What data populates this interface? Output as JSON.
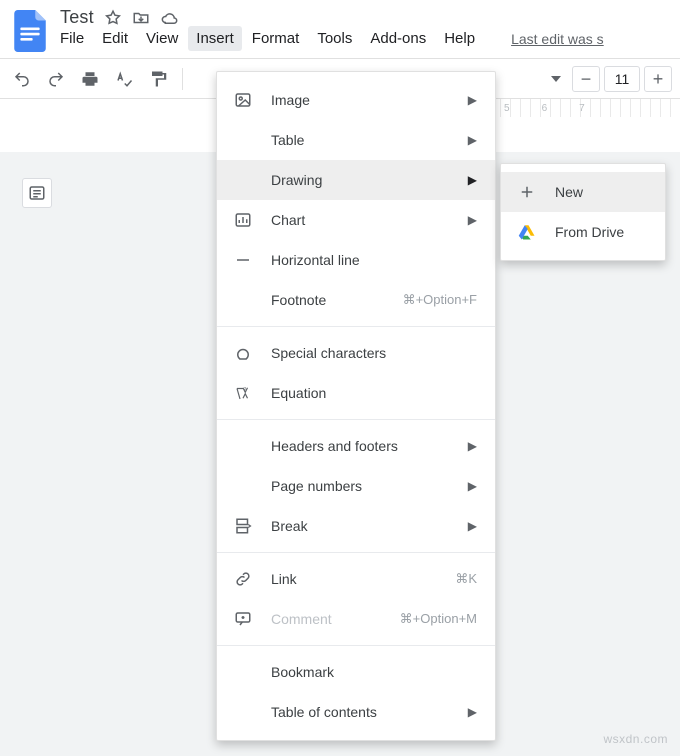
{
  "doc": {
    "title": "Test"
  },
  "menubar": {
    "items": [
      "File",
      "Edit",
      "View",
      "Insert",
      "Format",
      "Tools",
      "Add-ons",
      "Help"
    ],
    "active": "Insert",
    "last_edit": "Last edit was s"
  },
  "toolbar": {
    "font_size": "11"
  },
  "ruler": {
    "labels": [
      "5",
      "6",
      "7"
    ]
  },
  "insert_menu": {
    "items": [
      {
        "id": "image",
        "label": "Image",
        "has_submenu": true
      },
      {
        "id": "table",
        "label": "Table",
        "has_submenu": true
      },
      {
        "id": "drawing",
        "label": "Drawing",
        "has_submenu": true,
        "highlight": true
      },
      {
        "id": "chart",
        "label": "Chart",
        "has_submenu": true
      },
      {
        "id": "hr",
        "label": "Horizontal line"
      },
      {
        "id": "footnote",
        "label": "Footnote",
        "shortcut": "⌘+Option+F"
      },
      {
        "sep": true
      },
      {
        "id": "special",
        "label": "Special characters"
      },
      {
        "id": "equation",
        "label": "Equation"
      },
      {
        "sep": true
      },
      {
        "id": "headers",
        "label": "Headers and footers",
        "has_submenu": true
      },
      {
        "id": "pagenums",
        "label": "Page numbers",
        "has_submenu": true
      },
      {
        "id": "break",
        "label": "Break",
        "has_submenu": true
      },
      {
        "sep": true
      },
      {
        "id": "link",
        "label": "Link",
        "shortcut": "⌘K"
      },
      {
        "id": "comment",
        "label": "Comment",
        "shortcut": "⌘+Option+M",
        "disabled": true
      },
      {
        "sep": true
      },
      {
        "id": "bookmark",
        "label": "Bookmark"
      },
      {
        "id": "toc",
        "label": "Table of contents",
        "has_submenu": true
      }
    ]
  },
  "drawing_menu": {
    "items": [
      {
        "id": "new",
        "label": "New",
        "highlight": true
      },
      {
        "id": "fromdrive",
        "label": "From Drive"
      }
    ]
  },
  "watermark": "wsxdn.com"
}
